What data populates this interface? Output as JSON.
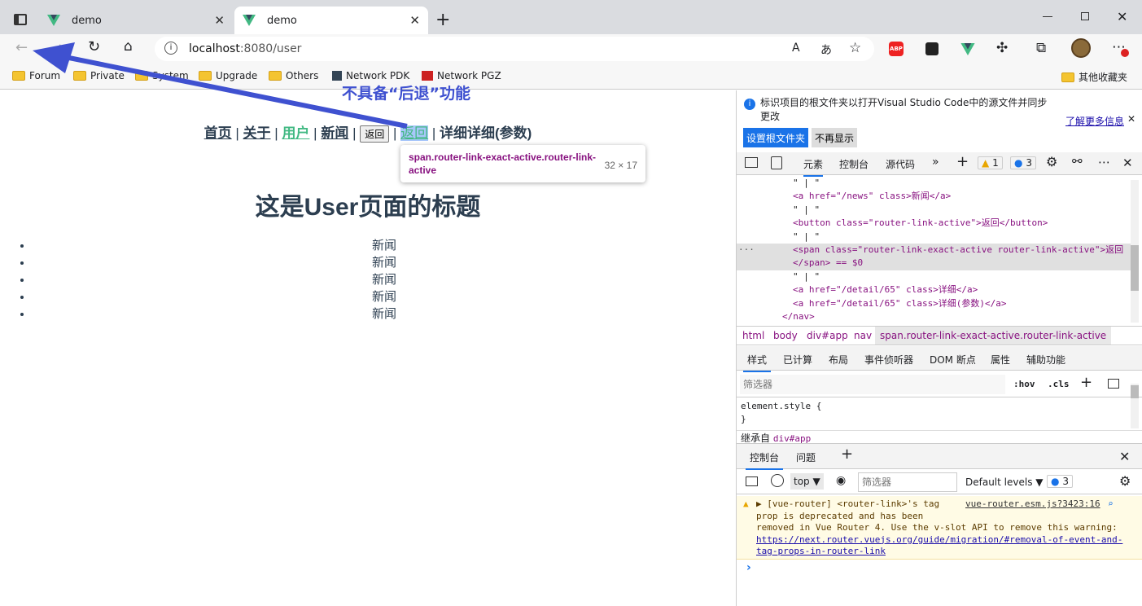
{
  "browser": {
    "tabs": [
      {
        "title": "demo"
      },
      {
        "title": "demo"
      }
    ],
    "url_host": "localhost",
    "url_rest": ":8080/user",
    "bookmarks": [
      "Forum",
      "Private",
      "System",
      "Upgrade",
      "Others",
      "Network PDK",
      "Network PGZ"
    ],
    "other_bookmarks": "其他收藏夹"
  },
  "annotation": {
    "text": "不具备“后退”功能"
  },
  "page": {
    "nav": [
      {
        "label": "首页"
      },
      {
        "label": "关于"
      },
      {
        "label": "用户"
      },
      {
        "label": "新闻"
      }
    ],
    "back_button": "返回",
    "back_span": "返回",
    "detail_label": "详细",
    "detail_param_label": "详细(参数)",
    "separator": "|",
    "title": "这是User页面的标题",
    "news_items": [
      "新闻",
      "新闻",
      "新闻",
      "新闻",
      "新闻"
    ]
  },
  "tooltip": {
    "selector": "span.router-link-exact-active.router-link-active",
    "size": "32 × 17"
  },
  "devtools": {
    "banner": "标识项目的根文件夹以打开Visual Studio Code中的源文件并同步更改",
    "learn_more": "了解更多信息",
    "set_root": "设置根文件夹",
    "dont_show": "不再显示",
    "tabs": [
      "元素",
      "控制台",
      "源代码"
    ],
    "warn_count": "1",
    "info_count": "3",
    "dom_lines": [
      "\" | \"",
      "<a href=\"/news\" class>新闻</a>",
      "\" | \"",
      "<button class=\"router-link-active\">返回</button>",
      "\" | \"",
      "<span class=\"router-link-exact-active router-link-active\">返回",
      "</span> == $0",
      "\" | \"",
      "<a href=\"/detail/65\" class>详细</a>",
      "<a href=\"/detail/65\" class>详细(参数)</a>",
      "</nav>"
    ],
    "breadcrumb": [
      "html",
      "body",
      "div#app",
      "nav",
      "span.router-link-exact-active.router-link-active"
    ],
    "style_tabs": [
      "样式",
      "已计算",
      "布局",
      "事件侦听器",
      "DOM 断点",
      "属性",
      "辅助功能"
    ],
    "filter_placeholder": "筛选器",
    "hov": ":hov",
    "cls": ".cls",
    "element_style": "element.style {",
    "close_brace": "}",
    "inherited": "继承自",
    "inherited_from": "div#app",
    "drawer_tabs": [
      "控制台",
      "问题"
    ],
    "context": "top",
    "console_filter": "筛选器",
    "levels": "Default levels",
    "levels_count": "3",
    "console_msg_1": "▶ [vue-router] <router-link>'s tag",
    "console_src": "vue-router.esm.js?3423:16",
    "console_msg_2": "prop is deprecated and has been",
    "console_msg_3": "removed in Vue Router 4. Use the v-slot API to remove this warning:",
    "console_link_1": "https://next.router.vuejs.org/guide/migration/#removal-of-event-and-",
    "console_link_2": "tag-props-in-router-link",
    "prompt": "›"
  },
  "colors": {
    "vue_green": "#42b983",
    "annotation_blue": "#3f51d0",
    "devtools_accent": "#1a73e8"
  }
}
